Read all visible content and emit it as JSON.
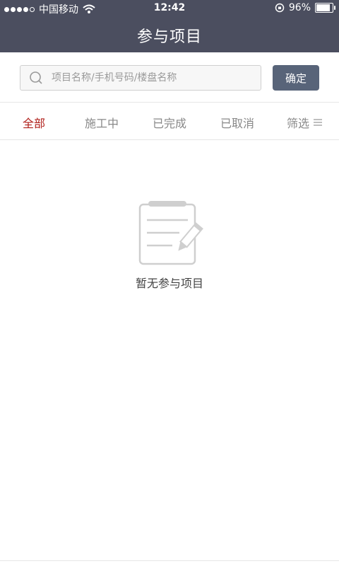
{
  "status_bar": {
    "carrier": "中国移动",
    "time": "12:42",
    "battery": "96%",
    "battery_level": 0.96
  },
  "header": {
    "title": "参与项目"
  },
  "search": {
    "placeholder": "项目名称/手机号码/楼盘名称",
    "confirm_label": "确定"
  },
  "tabs": [
    {
      "label": "全部"
    },
    {
      "label": "施工中"
    },
    {
      "label": "已完成"
    },
    {
      "label": "已取消"
    }
  ],
  "filter": {
    "label": "筛选"
  },
  "empty_state": {
    "message": "暂无参与项目"
  },
  "colors": {
    "header_bg": "#4b4e5f",
    "active_tab": "#b0201b",
    "confirm_bg": "#586479"
  }
}
